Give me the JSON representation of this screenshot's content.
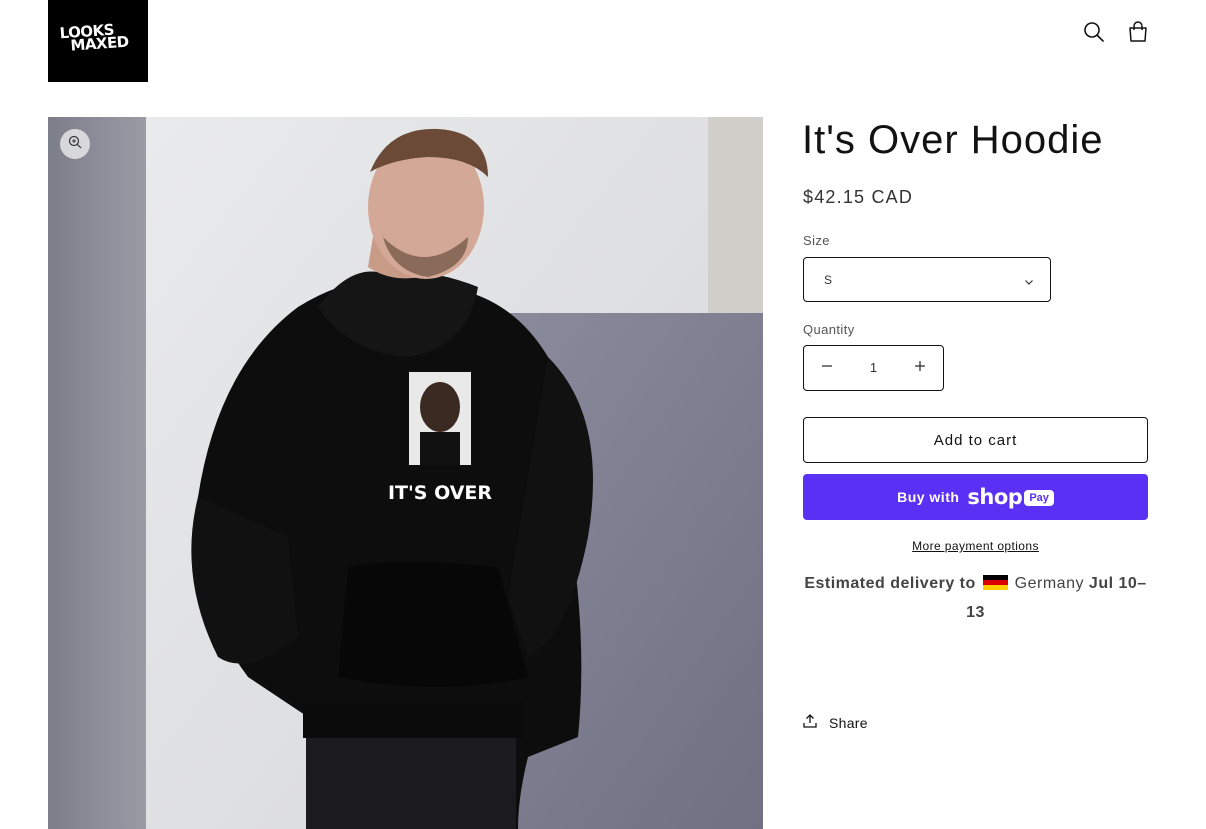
{
  "header": {
    "logo_line1": "LOOKS",
    "logo_line2": "MAXED",
    "search_icon": "search-icon",
    "cart_icon": "shopping-bag-icon"
  },
  "media": {
    "zoom_icon": "zoom-in-icon",
    "print_text": "IT'S OVER"
  },
  "product": {
    "title": "It's Over Hoodie",
    "price": "$42.15 CAD",
    "size_label": "Size",
    "size_value": "S",
    "quantity_label": "Quantity",
    "quantity_value": "1",
    "add_to_cart": "Add to cart",
    "buy_with": "Buy with",
    "shop_word": "shop",
    "pay_word": "Pay",
    "more_payment": "More payment options",
    "delivery_prefix": "Estimated delivery to",
    "delivery_country": "Germany",
    "delivery_dates": "Jul 10–13",
    "share": "Share"
  },
  "colors": {
    "shop_pay": "#5a31f4",
    "text": "#121212"
  }
}
